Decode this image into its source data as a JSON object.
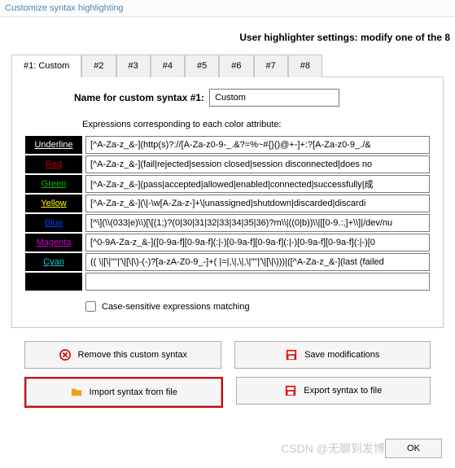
{
  "titlebar": "Customize syntax highlighting",
  "header": "User highlighter settings: modify one of the 8",
  "tabs": [
    "#1: Custom",
    "#2",
    "#3",
    "#4",
    "#5",
    "#6",
    "#7",
    "#8"
  ],
  "name_label": "Name for custom syntax #1:",
  "name_value": "Custom",
  "expr_label": "Expressions corresponding to each color attribute:",
  "rows": [
    {
      "label": "Underline",
      "color": "#ffffff",
      "expr": "[^A-Za-z_&-](http(s)?://[A-Za-z0-9-_.&?=%~#{}()@+-]+:?[A-Za-z0-9_./&"
    },
    {
      "label": "Red",
      "color": "#c00000",
      "expr": "[^A-Za-z_&-](fail|rejected|session closed|session disconnected|does no"
    },
    {
      "label": "Green",
      "color": "#00c000",
      "expr": "[^A-Za-z_&-](pass|accepted|allowed|enabled|connected|successfully|成"
    },
    {
      "label": "Yellow",
      "color": "#ffff00",
      "expr": "[^A-Za-z_&-](\\|-\\w[A-Za-z-]+\\|unassigned|shutdown|discarded|discardi"
    },
    {
      "label": "Blue",
      "color": "#0040ff",
      "expr": "[^\\](\\\\(033|e)\\\\)[\\[(1;)?(0|30|31|32|33|34|35|36)?m\\\\|((0|b))\\\\|[[0-9.:,]+\\\\]|/dev/nu"
    },
    {
      "label": "Magenta",
      "color": "#d000d0",
      "expr": "[^0-9A-Za-z_&-]([0-9a-f][0-9a-f](:|-)[0-9a-f][0-9a-f](:|-)[0-9a-f][0-9a-f](:|-)[0"
    },
    {
      "label": "Cyan",
      "color": "#00d0d0",
      "expr": "(( \\|[\\|\"\"|'\\|[\\|\\)-(-)?[a-zA-Z0-9_-]+( |=|,\\|,\\|,\\|\"\"|'\\|[\\|\\)))|([^A-Za-z_&-](last (failed"
    },
    {
      "label": "",
      "color": "#000000",
      "expr": ""
    }
  ],
  "case_label": "Case-sensitive expressions matching",
  "btn_remove": "Remove this custom syntax",
  "btn_save": "Save modifications",
  "btn_import": "Import syntax from file",
  "btn_export": "Export syntax to file",
  "btn_ok": "OK",
  "watermark": "CSDN @无聊到发博客的菜鸟"
}
